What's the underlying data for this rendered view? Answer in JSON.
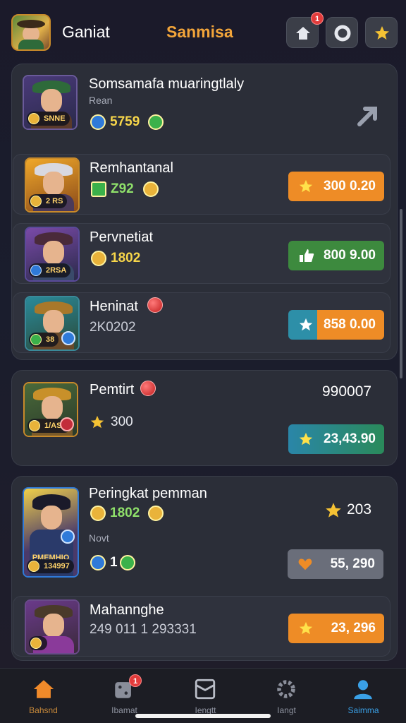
{
  "header": {
    "game_name": "Ganiat",
    "screen_title": "Sanmisa",
    "home_badge": "1",
    "icons": [
      "home-icon",
      "settings-gear-icon",
      "star-reward-icon"
    ]
  },
  "group1": {
    "rows": [
      {
        "name": "Somsamafa muaringtlaly",
        "sub": "Rean",
        "stat": "5759",
        "avatar_tag": "SNNE",
        "action_icon": "share-icon"
      },
      {
        "name": "Remhantanal",
        "stat": "Z92",
        "avatar_tag": "2 RS",
        "button": "300 0.20",
        "button_color": "#ee8c26"
      },
      {
        "name": "Pervnetiat",
        "stat": "1802",
        "avatar_tag": "2RSA",
        "button": "800 9.00",
        "button_color": "#3d8a3e"
      },
      {
        "name": "Heninat",
        "stat": "2K0202",
        "avatar_tag": "38",
        "button": "858 0.00",
        "button_color": "#ee8c26"
      }
    ]
  },
  "card_feature": {
    "name": "Pemtirt",
    "stat": "300",
    "avatar_tag": "1/ASS",
    "value": "990007",
    "button": "23,43.90"
  },
  "group2": {
    "header": {
      "name": "Peringkat pemman",
      "stat": "1802",
      "note": "Novt",
      "stat2": "1",
      "avatar_tag": "134997",
      "avatar_title": "PMEMHIO",
      "star_value": "203",
      "button": "55, 290"
    },
    "row": {
      "name": "Mahannghe",
      "stat": "249 011 1 293331",
      "button": "23, 296"
    }
  },
  "nav": [
    {
      "label": "Bahsnd",
      "icon": "home-icon",
      "active": true
    },
    {
      "label": "Ibamat",
      "icon": "dice-icon",
      "badge": "1"
    },
    {
      "label": "Iengtt",
      "icon": "card-icon"
    },
    {
      "label": "Iangt",
      "icon": "gear-icon"
    },
    {
      "label": "Saimma",
      "icon": "profile-icon",
      "active_color": "#3aa0e6"
    }
  ]
}
